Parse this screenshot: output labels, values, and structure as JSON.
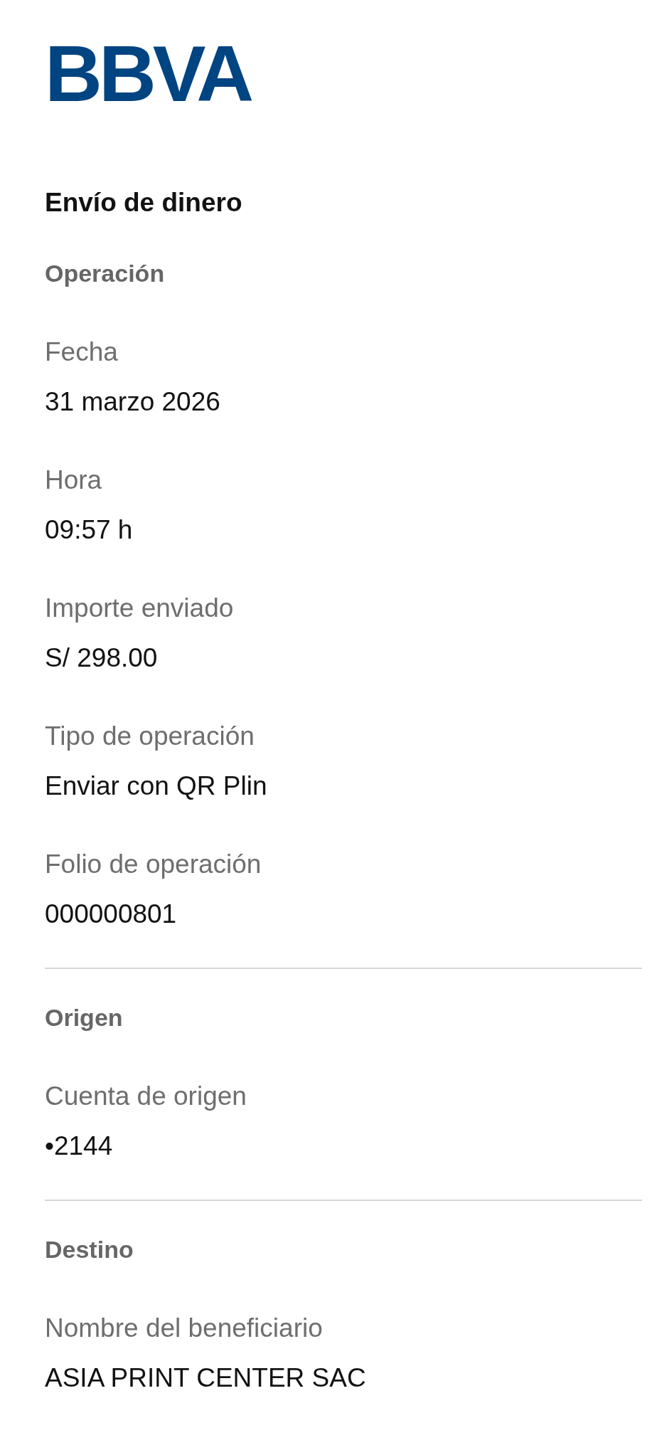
{
  "logo": {
    "text": "BBVA"
  },
  "title": "Envío de dinero",
  "sections": [
    {
      "header": "Operación",
      "fields": [
        {
          "label": "Fecha",
          "value": "31 marzo 2026"
        },
        {
          "label": "Hora",
          "value": "09:57 h"
        },
        {
          "label": "Importe enviado",
          "value": "S/ 298.00"
        },
        {
          "label": "Tipo de operación",
          "value": "Enviar con QR Plin"
        },
        {
          "label": "Folio de operación",
          "value": "000000801"
        }
      ]
    },
    {
      "header": "Origen",
      "fields": [
        {
          "label": "Cuenta de origen",
          "value": "•2144"
        }
      ]
    },
    {
      "header": "Destino",
      "fields": [
        {
          "label": "Nombre del beneficiario",
          "value": "ASIA PRINT CENTER SAC"
        }
      ]
    }
  ]
}
